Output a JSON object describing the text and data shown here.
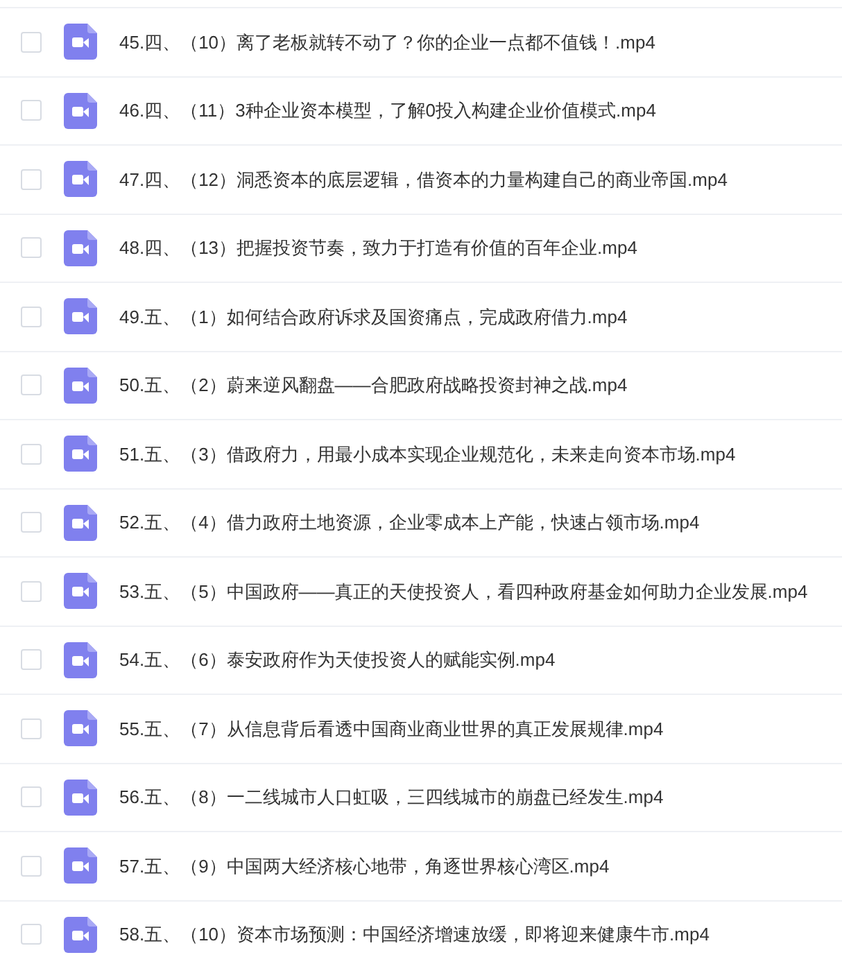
{
  "files": [
    {
      "name": "45.四、（10）离了老板就转不动了？你的企业一点都不值钱！.mp4",
      "checked": false
    },
    {
      "name": "46.四、（11）3种企业资本模型，了解0投入构建企业价值模式.mp4",
      "checked": false
    },
    {
      "name": "47.四、（12）洞悉资本的底层逻辑，借资本的力量构建自己的商业帝国.mp4",
      "checked": false
    },
    {
      "name": "48.四、（13）把握投资节奏，致力于打造有价值的百年企业.mp4",
      "checked": false
    },
    {
      "name": "49.五、（1）如何结合政府诉求及国资痛点，完成政府借力.mp4",
      "checked": false
    },
    {
      "name": "50.五、（2）蔚来逆风翻盘——合肥政府战略投资封神之战.mp4",
      "checked": false
    },
    {
      "name": "51.五、（3）借政府力，用最小成本实现企业规范化，未来走向资本市场.mp4",
      "checked": false
    },
    {
      "name": "52.五、（4）借力政府土地资源，企业零成本上产能，快速占领市场.mp4",
      "checked": false
    },
    {
      "name": "53.五、（5）中国政府——真正的天使投资人，看四种政府基金如何助力企业发展.mp4",
      "checked": false
    },
    {
      "name": "54.五、（6）泰安政府作为天使投资人的赋能实例.mp4",
      "checked": false
    },
    {
      "name": "55.五、（7）从信息背后看透中国商业商业世界的真正发展规律.mp4",
      "checked": false
    },
    {
      "name": "56.五、（8）一二线城市人口虹吸，三四线城市的崩盘已经发生.mp4",
      "checked": false
    },
    {
      "name": "57.五、（9）中国两大经济核心地带，角逐世界核心湾区.mp4",
      "checked": false
    },
    {
      "name": "58.五、（10）资本市场预测：中国经济增速放缓，即将迎来健康牛市.mp4",
      "checked": false
    }
  ]
}
